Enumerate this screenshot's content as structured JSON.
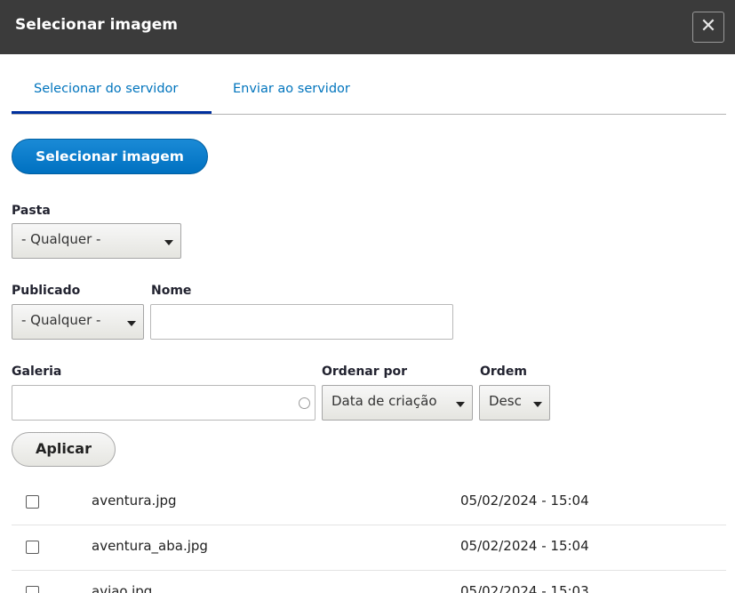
{
  "dialog": {
    "title": "Selecionar imagem",
    "close_label": "✕"
  },
  "tabs": [
    {
      "label": "Selecionar do servidor",
      "active": true
    },
    {
      "label": "Enviar ao servidor",
      "active": false
    }
  ],
  "select_button_label": "Selecionar imagem",
  "filters": {
    "pasta": {
      "label": "Pasta",
      "value": "- Qualquer -"
    },
    "publicado": {
      "label": "Publicado",
      "value": "- Qualquer -"
    },
    "nome": {
      "label": "Nome",
      "value": ""
    },
    "galeria": {
      "label": "Galeria",
      "value": ""
    },
    "ordenar_por": {
      "label": "Ordenar por",
      "value": "Data de criação"
    },
    "ordem": {
      "label": "Ordem",
      "value": "Desc"
    }
  },
  "apply_label": "Aplicar",
  "files": [
    {
      "name": "aventura.jpg",
      "date": "05/02/2024 - 15:04",
      "checked": false
    },
    {
      "name": "aventura_aba.jpg",
      "date": "05/02/2024 - 15:04",
      "checked": false
    },
    {
      "name": "aviao.jpg",
      "date": "05/02/2024 - 15:03",
      "checked": false
    }
  ],
  "colors": {
    "titlebar": "#3b3b3b",
    "link": "#0074bd",
    "tab_active_underline": "#00309e",
    "primary_button": "#0071c1"
  }
}
